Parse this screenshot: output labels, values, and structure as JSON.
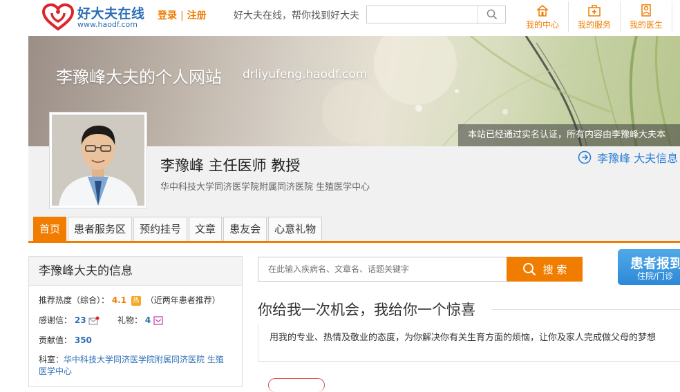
{
  "header": {
    "logo_cn": "好大夫在线",
    "logo_url": "www.haodf.com",
    "login": "登录",
    "register": "注册",
    "auth_sep": "|",
    "slogan": "好大夫在线，帮你找到好大夫",
    "search_placeholder": "",
    "nav": [
      {
        "label": "我的中心",
        "icon": "home-icon"
      },
      {
        "label": "我的服务",
        "icon": "medical-kit-icon"
      },
      {
        "label": "我的医生",
        "icon": "doctor-icon"
      }
    ]
  },
  "banner": {
    "site_title": "李豫峰大夫的个人网站",
    "site_url": "drliyufeng.haodf.com",
    "verify_notice": "本站已经通过实名认证，所有内容由李豫峰大夫本"
  },
  "doctor": {
    "name_title": "李豫峰  主任医师 教授",
    "hospital": "华中科技大学同济医学院附属同济医院  生殖医学中心",
    "info_link": "李豫峰 大夫信息"
  },
  "tabs": [
    {
      "label": "首页",
      "active": true
    },
    {
      "label": "患者服务区",
      "active": false
    },
    {
      "label": "预约挂号",
      "active": false
    },
    {
      "label": "文章",
      "active": false
    },
    {
      "label": "患友会",
      "active": false
    },
    {
      "label": "心意礼物",
      "active": false
    }
  ],
  "info_panel": {
    "heading": "李豫峰大夫的信息",
    "recommend_label": "推荐热度（综合）：",
    "recommend_value": "4.1",
    "hot_badge": "热",
    "recommend_note": "（近两年患者推荐）",
    "thanks_label": "感谢信：",
    "thanks_value": "23",
    "gift_label": "礼物：",
    "gift_value": "4",
    "contribution_label": "贡献值：",
    "contribution_value": "350",
    "dept_label": "科室：",
    "dept_line1": "华中科技大学同济医学院附属同济医院 生殖",
    "dept_line2": "医学中心"
  },
  "main_search": {
    "placeholder": "在此输入疾病名、文章名、话题关键字",
    "button": "搜 索"
  },
  "report_button": {
    "line1": "患者报到",
    "line2": "住院/门诊"
  },
  "promise": {
    "title": "你给我一次机会，我给你一个惊喜",
    "body": "用我的专业、热情及敬业的态度，为你解决你有关生育方面的烦恼，让你及家人完成做父母的梦想"
  },
  "colors": {
    "accent": "#f07c00",
    "brand_blue": "#2d6fb6",
    "link_blue": "#2d7fd6"
  }
}
